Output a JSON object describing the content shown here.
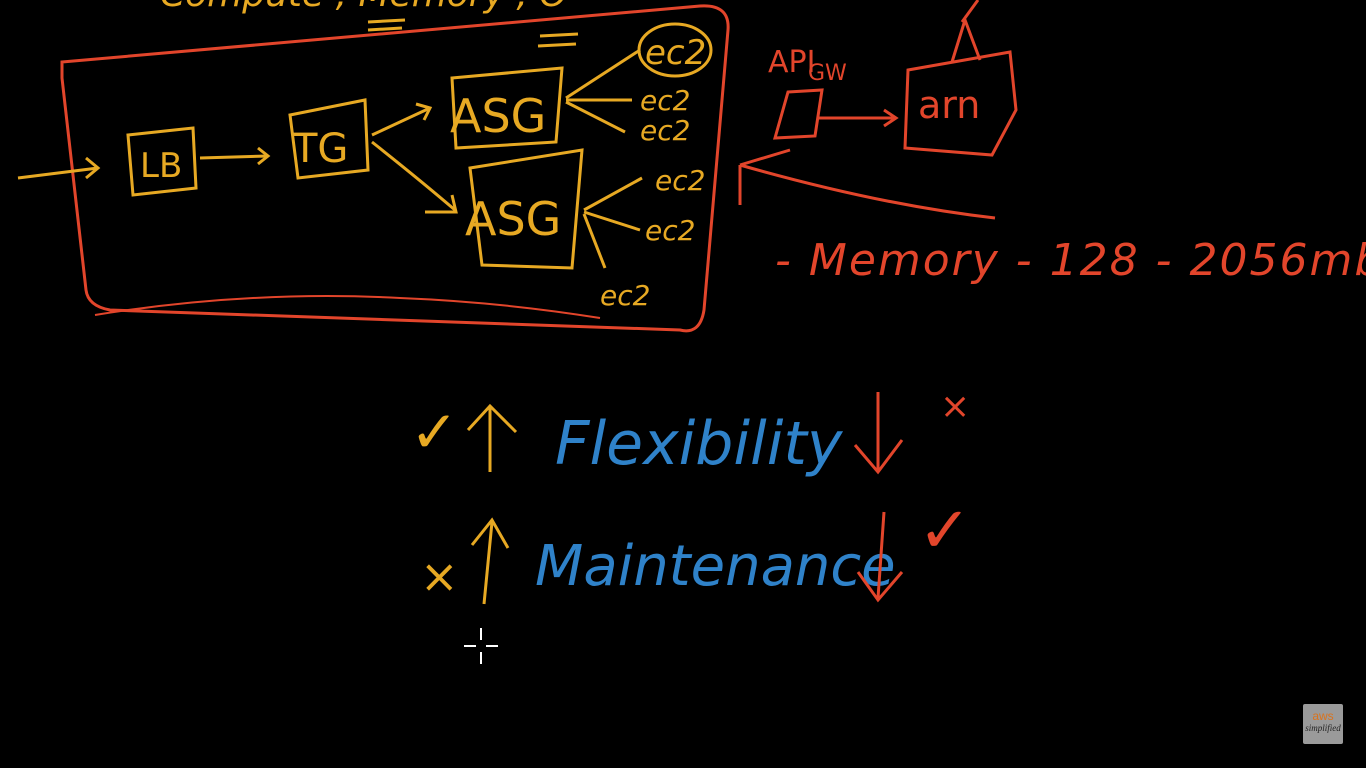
{
  "colors": {
    "background": "#000000",
    "yellow": "#e7a923",
    "red": "#e2452b",
    "blue": "#2f82c9",
    "cursor": "#ffffff"
  },
  "diagram": {
    "top_text": "Compute , Memory , O",
    "box1": "LB",
    "box2": "TG",
    "asg_top": "ASG",
    "asg_bottom": "ASG",
    "ec2_labels": [
      "ec2",
      "ec2",
      "ec2",
      "ec2",
      "ec2",
      "ec2"
    ],
    "api_gw": {
      "line1": "API",
      "line2": "GW"
    },
    "arn": "arn",
    "memory_note": "- Memory - 128 - 2056mb"
  },
  "comparison": {
    "flexibility": {
      "label": "Flexibility",
      "left_mark": "✓",
      "right_mark": "×"
    },
    "maintenance": {
      "label": "Maintenance",
      "left_mark": "×",
      "right_mark": "✓"
    }
  },
  "watermark": {
    "line1": "aws",
    "line2": "simplified"
  },
  "icons": [
    "crosshair-cursor-icon"
  ]
}
